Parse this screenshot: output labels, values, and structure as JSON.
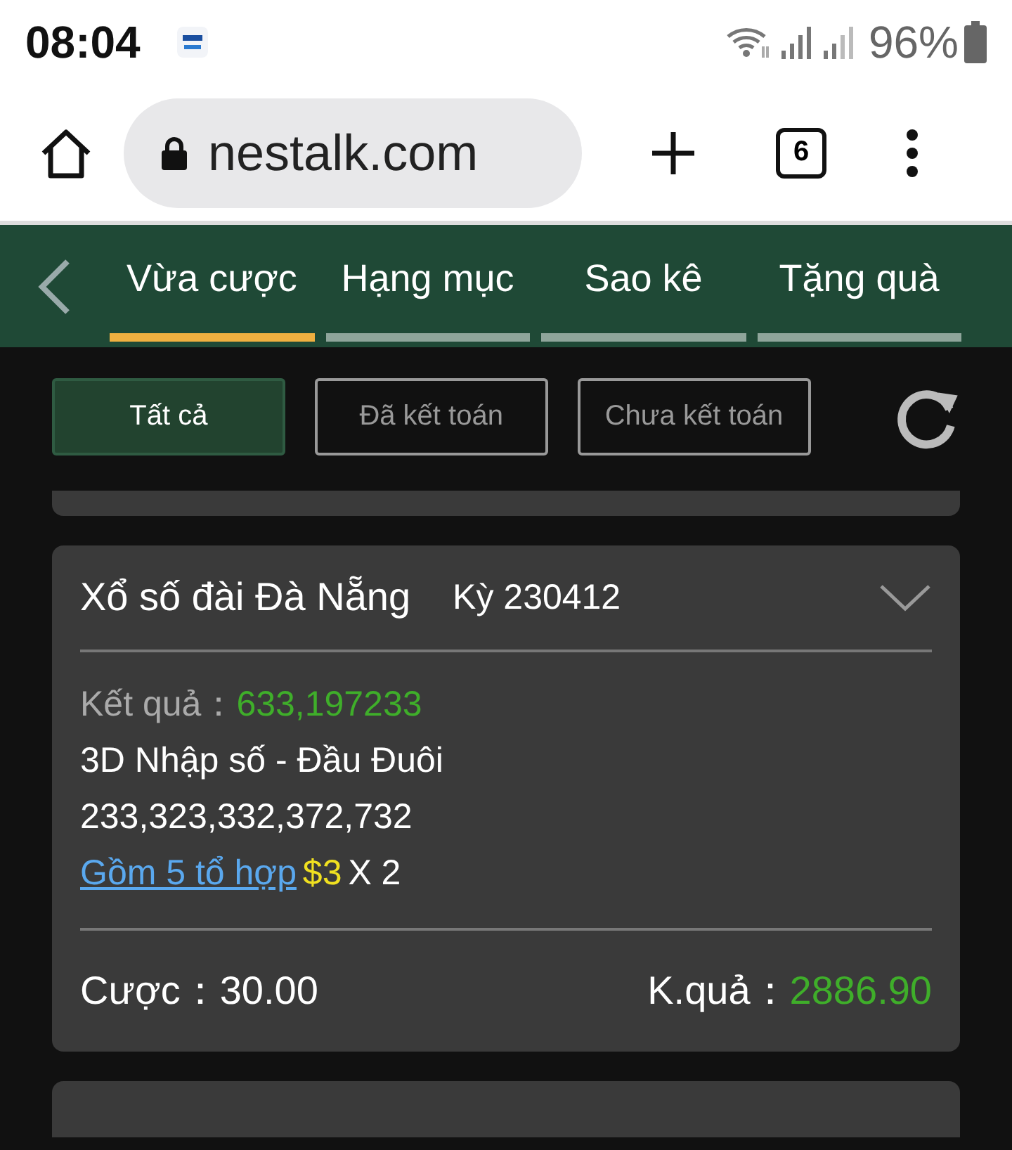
{
  "status_bar": {
    "time": "08:04",
    "battery": "96%"
  },
  "browser": {
    "url": "nestalk.com",
    "tab_count": "6"
  },
  "nav_tabs": [
    {
      "label": "Vừa cược",
      "selected": true
    },
    {
      "label": "Hạng mục",
      "selected": false
    },
    {
      "label": "Sao kê",
      "selected": false
    },
    {
      "label": "Tặng quà",
      "selected": false
    }
  ],
  "filters": [
    {
      "label": "Tất cả",
      "selected": true
    },
    {
      "label": "Đã kết toán",
      "selected": false
    },
    {
      "label": "Chưa kết toán",
      "selected": false
    }
  ],
  "bet_card": {
    "title": "Xổ số đài Đà Nẵng",
    "period": "Kỳ 230412",
    "result_label": "Kết quả：",
    "result": "633,197233",
    "bet_type": "3D Nhập số - Đầu Đuôi",
    "numbers": "233,323,332,372,732",
    "combos_link": "Gồm 5 tổ hợp",
    "amount": "$3",
    "multiplier": "X 2",
    "stake_label": "Cược：",
    "stake": "30.00",
    "payout_label": "K.quả：",
    "payout": "2886.90"
  }
}
